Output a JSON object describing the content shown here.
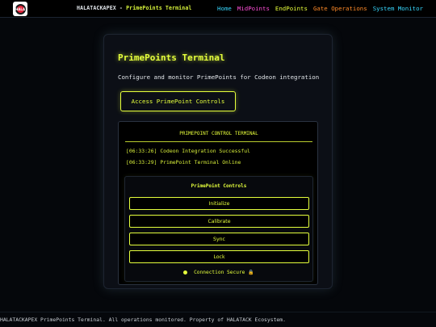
{
  "header": {
    "logo_text": "HALA",
    "brand": "HALATACKAPEX",
    "separator": " - ",
    "subtitle": "PrimePoints Terminal",
    "nav": [
      "Home",
      "MidPoints",
      "EndPoints",
      "Gate Operations",
      "System Monitor"
    ]
  },
  "main": {
    "title": "PrimePoints Terminal",
    "description": "Configure and monitor PrimePoints for Codeon integration",
    "access_button": "Access PrimePoint Controls",
    "terminal": {
      "heading": "PRIMEPOINT CONTROL TERMINAL",
      "logs": [
        "[06:33:26] Codeon Integration Successful",
        "[06:33:29] PrimePoint Terminal Online"
      ],
      "controls": {
        "title": "PrimePoint Controls",
        "buttons": [
          "Initialize",
          "Calibrate",
          "Sync",
          "Lock"
        ],
        "status": "Connection Secure",
        "status_icon": "lock-icon"
      }
    }
  },
  "footer": {
    "text": "HALATACKAPEX PrimePoints Terminal. All operations monitored. Property of HALATACK Ecosystem."
  },
  "colors": {
    "accent": "#e5ff3c",
    "home": "#37d8ff",
    "midpoints": "#ff4fd8",
    "gate": "#ff8a28",
    "background": "#05070b"
  }
}
